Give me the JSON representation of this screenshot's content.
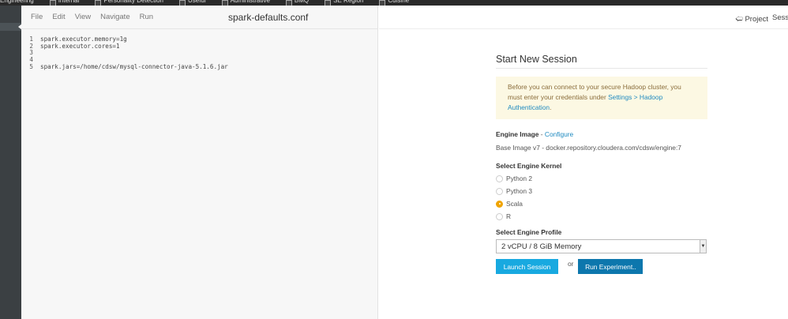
{
  "bookmarks": [
    "Engineering",
    "Internal",
    "Personality Detection",
    "Useful",
    "Administrative",
    "BMQ",
    "SE Region",
    "Cuisine"
  ],
  "editor": {
    "menu": [
      "File",
      "Edit",
      "View",
      "Navigate",
      "Run"
    ],
    "filename": "spark-defaults.conf",
    "lines": [
      {
        "n": "1",
        "t": "spark.executor.memory=1g"
      },
      {
        "n": "2",
        "t": "spark.executor.cores=1"
      },
      {
        "n": "3",
        "t": ""
      },
      {
        "n": "4",
        "t": ""
      },
      {
        "n": "5",
        "t": "spark.jars=/home/cdsw/mysql-connector-java-5.1.6.jar"
      }
    ]
  },
  "header": {
    "project": "Project",
    "session": "Sessi"
  },
  "session": {
    "title": "Start New Session",
    "alert_text": "Before you can connect to your secure Hadoop cluster, you must enter your credentials under ",
    "alert_link": "Settings > Hadoop Authentication",
    "alert_end": ".",
    "engine_image_label": "Engine Image",
    "engine_image_sep": " - ",
    "configure": "Configure",
    "base_image": "Base Image v7 - docker.repository.cloudera.com/cdsw/engine:7",
    "kernel_label": "Select Engine Kernel",
    "kernels": [
      "Python 2",
      "Python 3",
      "Scala",
      "R"
    ],
    "selected_kernel": "Scala",
    "profile_label": "Select Engine Profile",
    "profile_value": "2 vCPU / 8 GiB Memory",
    "launch": "Launch Session",
    "or": "or",
    "run_experiment": "Run Experiment.."
  },
  "colors": {
    "launch": "#18a9e0",
    "run": "#0d77ad",
    "accent": "#f0a400"
  }
}
